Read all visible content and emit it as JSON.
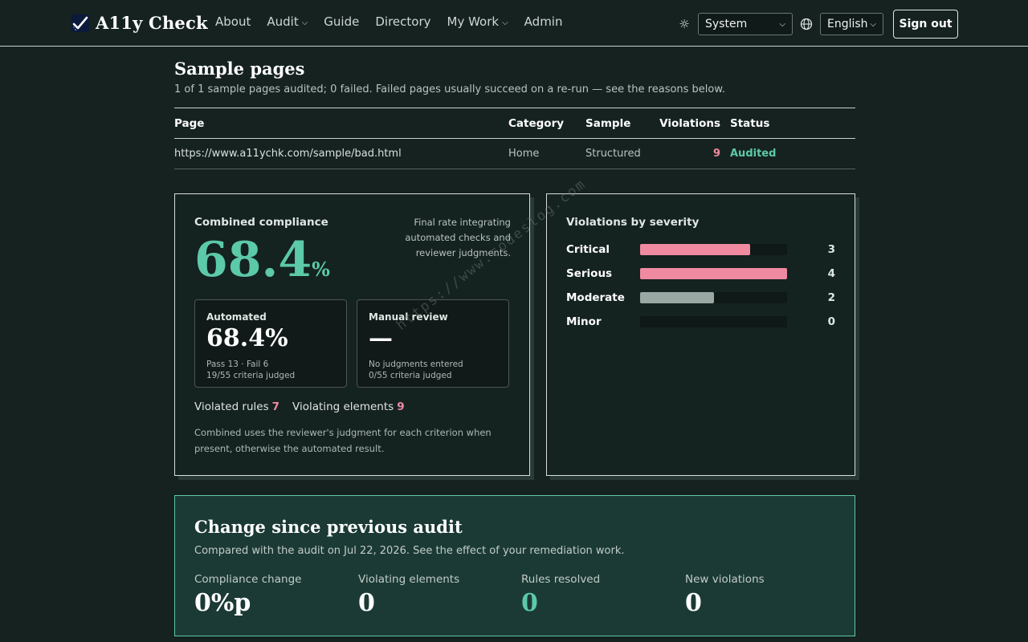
{
  "header": {
    "brand": "A11y Check",
    "nav": [
      {
        "label": "About",
        "has_menu": false
      },
      {
        "label": "Audit",
        "has_menu": true
      },
      {
        "label": "Guide",
        "has_menu": false
      },
      {
        "label": "Directory",
        "has_menu": false
      },
      {
        "label": "My Work",
        "has_menu": true
      },
      {
        "label": "Admin",
        "has_menu": false
      }
    ],
    "theme_select": "System",
    "language_select": "English",
    "sign_out": "Sign out",
    "icons": {
      "theme": "sun-icon",
      "language": "globe-icon"
    }
  },
  "sample_pages": {
    "title": "Sample pages",
    "subtitle": "1 of 1 sample pages audited; 0 failed. Failed pages usually succeed on a re-run — see the reasons below.",
    "columns": [
      "Page",
      "Category",
      "Sample",
      "Violations",
      "Status"
    ],
    "rows": [
      {
        "page": "https://www.a11ychk.com/sample/bad.html",
        "category": "Home",
        "sample": "Structured",
        "violations": "9",
        "status": "Audited"
      }
    ]
  },
  "compliance": {
    "title": "Combined compliance",
    "note": "Final rate integrating automated checks and reviewer judgments.",
    "rate": "68.4",
    "rate_unit": "%",
    "automated": {
      "label": "Automated",
      "value": "68.4%",
      "line1": "Pass 13 · Fail 6",
      "line2": "19/55 criteria judged"
    },
    "manual": {
      "label": "Manual review",
      "value": "—",
      "line1": "No judgments entered",
      "line2": "0/55 criteria judged"
    },
    "violated_rules_label": "Violated rules",
    "violated_rules": "7",
    "violating_elements_label": "Violating elements",
    "violating_elements": "9",
    "footnote": "Combined uses the reviewer's judgment for each criterion when present, otherwise the automated result."
  },
  "severity": {
    "title": "Violations by severity",
    "max": 4,
    "items": [
      {
        "name": "Critical",
        "count": 3,
        "color": "#ef8aa1"
      },
      {
        "name": "Serious",
        "count": 4,
        "color": "#ef8aa1"
      },
      {
        "name": "Moderate",
        "count": 2,
        "color": "#9aa8a3"
      },
      {
        "name": "Minor",
        "count": 0,
        "color": "#9aa8a3"
      }
    ]
  },
  "change": {
    "title": "Change since previous audit",
    "subtitle": "Compared with the audit on Jul 22, 2026. See the effect of your remediation work.",
    "metrics": [
      {
        "label": "Compliance change",
        "value": "0%p"
      },
      {
        "label": "Violating elements",
        "value": "0"
      },
      {
        "label": "Rules resolved",
        "value": "0"
      },
      {
        "label": "New violations",
        "value": "0"
      }
    ]
  },
  "watermark": "https://www.codeslog.com",
  "colors": {
    "accent": "#5cc9a8",
    "danger": "#ef8aa1",
    "background": "#152220"
  }
}
